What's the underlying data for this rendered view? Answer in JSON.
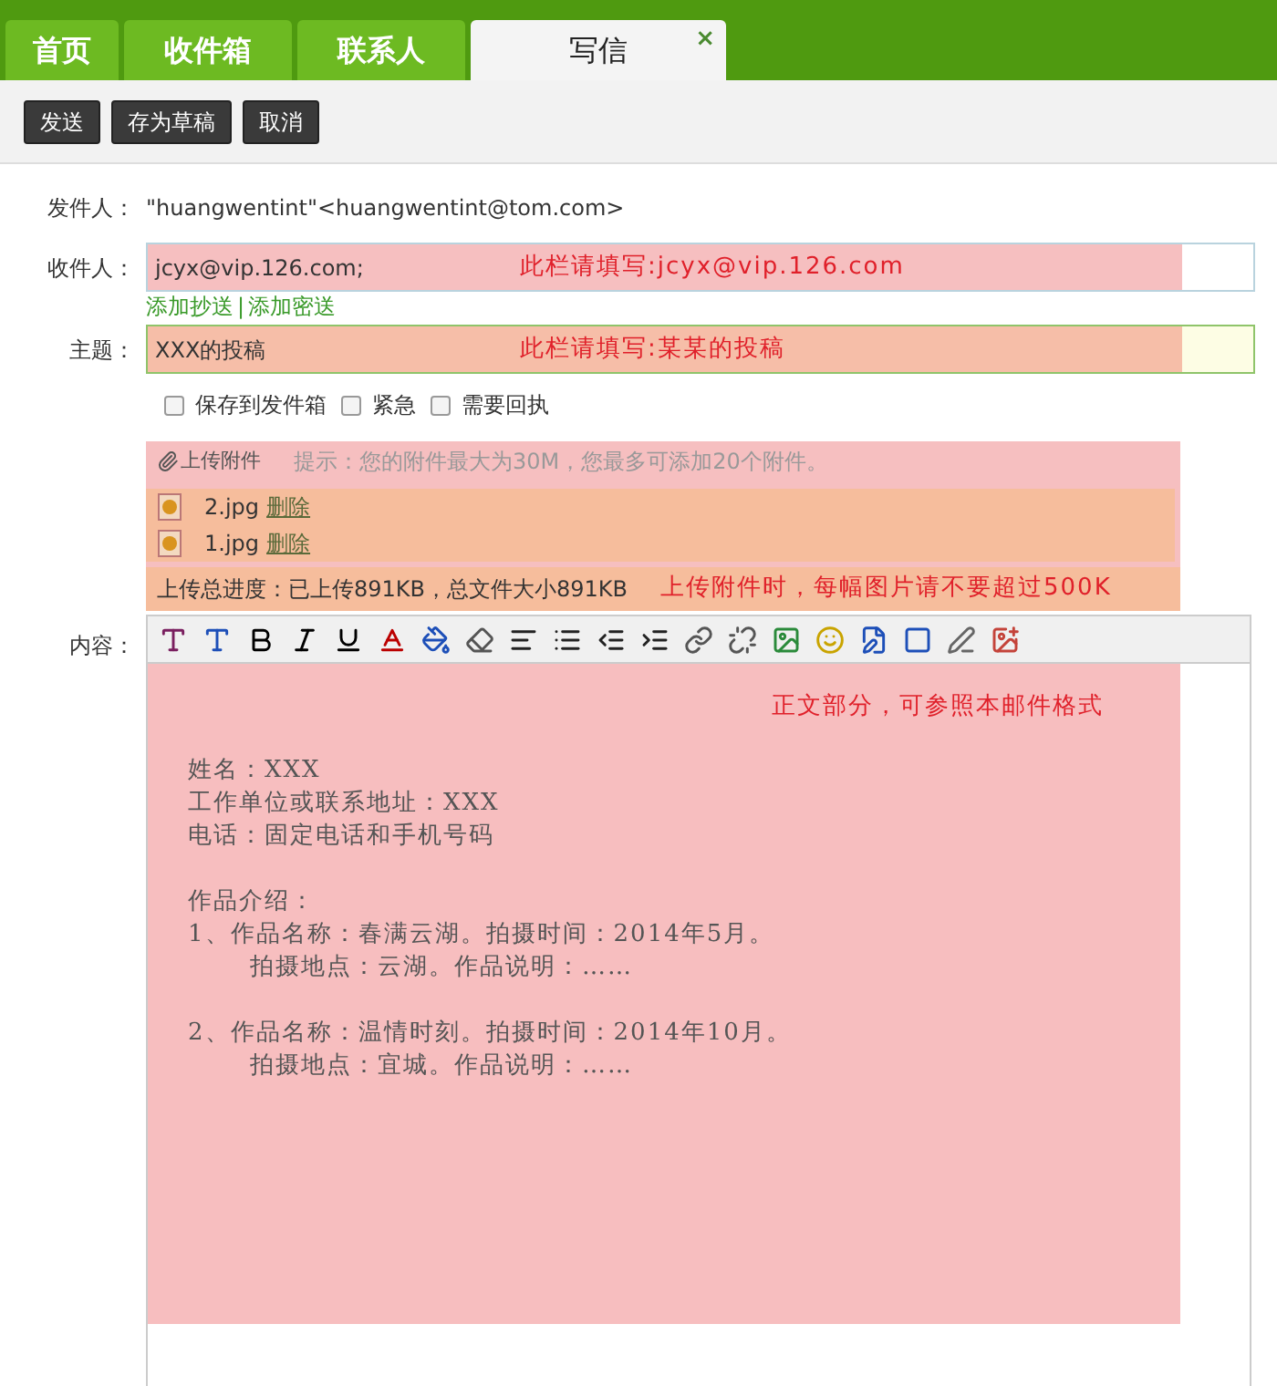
{
  "tabs": [
    {
      "label": "首页",
      "selected": false
    },
    {
      "label": "收件箱",
      "selected": false
    },
    {
      "label": "联系人",
      "selected": false
    },
    {
      "label": "写信",
      "selected": true,
      "close": "×"
    }
  ],
  "actions": [
    "发送",
    "存为草稿",
    "取消"
  ],
  "sender": {
    "label": "发件人：",
    "value": "\"huangwentint\"<huangwentint@tom.com>"
  },
  "recipient": {
    "label": "收件人：",
    "value": "jcyx@vip.126.com;",
    "note": "此栏请填写:jcyx@vip.126.com"
  },
  "cc_links": [
    "添加抄送",
    "添加密送"
  ],
  "cc_separator": "|",
  "subject": {
    "label": "主题：",
    "value": "XXX的投稿",
    "note": "此栏请填写:某某的投稿"
  },
  "options": [
    {
      "label": "保存到发件箱",
      "checked": false
    },
    {
      "label": "紧急",
      "checked": false
    },
    {
      "label": "需要回执",
      "checked": false
    }
  ],
  "attachments": {
    "upload": "上传附件",
    "hint": "提示：您的附件最大为30M，您最多可添加20个附件。",
    "files": [
      {
        "name": "2.jpg",
        "action": "删除"
      },
      {
        "name": "1.jpg",
        "action": "删除"
      }
    ],
    "progress": "上传总进度：已上传891KB，总文件大小891KB",
    "note": "上传附件时，每幅图片请不要超过500K"
  },
  "content": {
    "label": "内容：",
    "note": "正文部分，可参照本邮件格式",
    "paragraphs": [
      [
        {
          "text": "姓名：XXX"
        },
        {
          "text": "工作单位或联系地址：XXX"
        },
        {
          "text": "电话：固定电话和手机号码"
        }
      ],
      [
        {
          "text": "作品介绍："
        },
        {
          "text": "1、作品名称：春满云湖。拍摄时间：2014年5月。",
          "children": [
            {
              "text": "拍摄地点：云湖。作品说明：……"
            }
          ]
        }
      ],
      [
        {
          "text": "2、作品名称：温情时刻。拍摄时间：2014年10月。",
          "children": [
            {
              "text": "拍摄地点：宜城。作品说明：……"
            }
          ]
        }
      ]
    ]
  }
}
